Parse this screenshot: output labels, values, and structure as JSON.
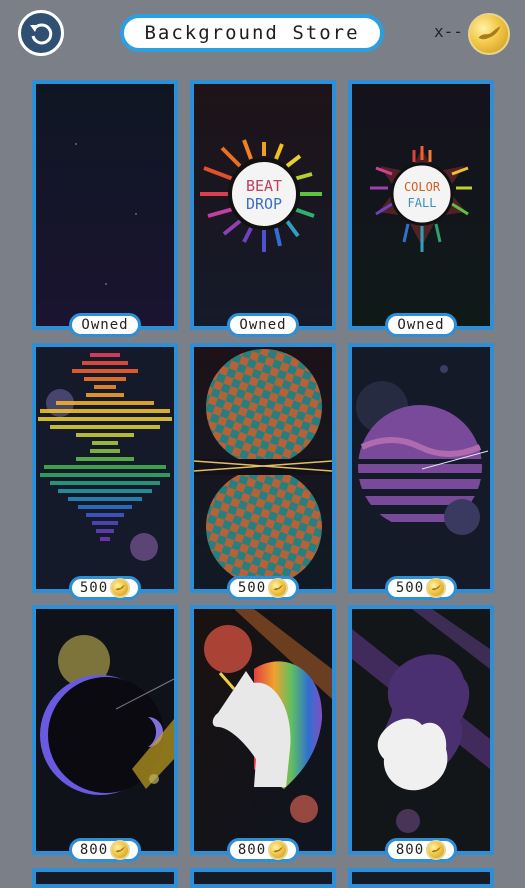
{
  "header": {
    "title": "Background Store",
    "currency_value": "x--"
  },
  "items": [
    {
      "name": "Dark Space",
      "status": "Owned",
      "price": ""
    },
    {
      "name": "Beat Drop",
      "status": "Owned",
      "price": "",
      "logo_line1": "BEAT",
      "logo_line2": "DROP"
    },
    {
      "name": "Color Fall",
      "status": "Owned",
      "price": "",
      "logo_line1": "COLOR",
      "logo_line2": "FALL"
    },
    {
      "name": "Rainbow Wave",
      "status": "",
      "price": "500"
    },
    {
      "name": "Checker Planets",
      "status": "",
      "price": "500"
    },
    {
      "name": "Retro Planet",
      "status": "",
      "price": "500"
    },
    {
      "name": "Eclipse",
      "status": "",
      "price": "800"
    },
    {
      "name": "Unicorn",
      "status": "",
      "price": "800"
    },
    {
      "name": "Lion",
      "status": "",
      "price": "800"
    }
  ],
  "colors": {
    "background": "#7b7f87",
    "card_border": "#2e8fd6",
    "coin": "#f2c746",
    "back_button": "#2f4f73"
  }
}
